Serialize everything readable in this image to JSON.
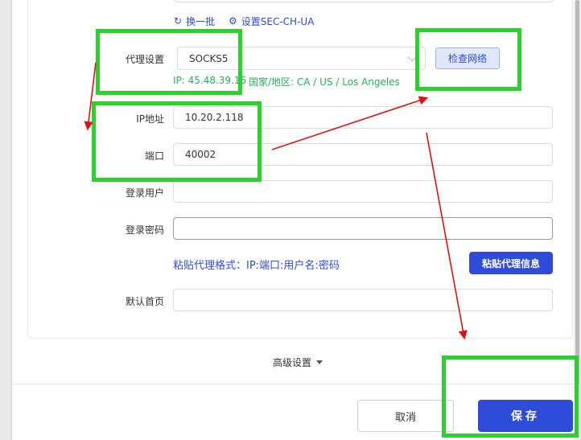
{
  "links": {
    "refresh_batch": "换一批",
    "set_sec_ch_ua": "设置SEC-CH-UA"
  },
  "proxy": {
    "label": "代理设置",
    "type_value": "SOCKS5",
    "check_button": "检查网络",
    "ip_info": "IP: 45.48.39.16",
    "region_info": "国家/地区: CA / US / Los Angeles"
  },
  "fields": {
    "ip_label": "IP地址",
    "ip_value": "10.20.2.118",
    "port_label": "端口",
    "port_value": "40002",
    "user_label": "登录用户",
    "user_value": "",
    "password_label": "登录密码",
    "password_value": "",
    "homepage_label": "默认首页",
    "homepage_value": ""
  },
  "paste": {
    "format_hint": "粘贴代理格式：IP:端口:用户名:密码",
    "button": "粘贴代理信息"
  },
  "advanced": {
    "label": "高级设置"
  },
  "footer": {
    "cancel": "取消",
    "save": "保存"
  },
  "annotation": {
    "box_color": "#2dd12d",
    "arrow_color": "#e01010"
  }
}
